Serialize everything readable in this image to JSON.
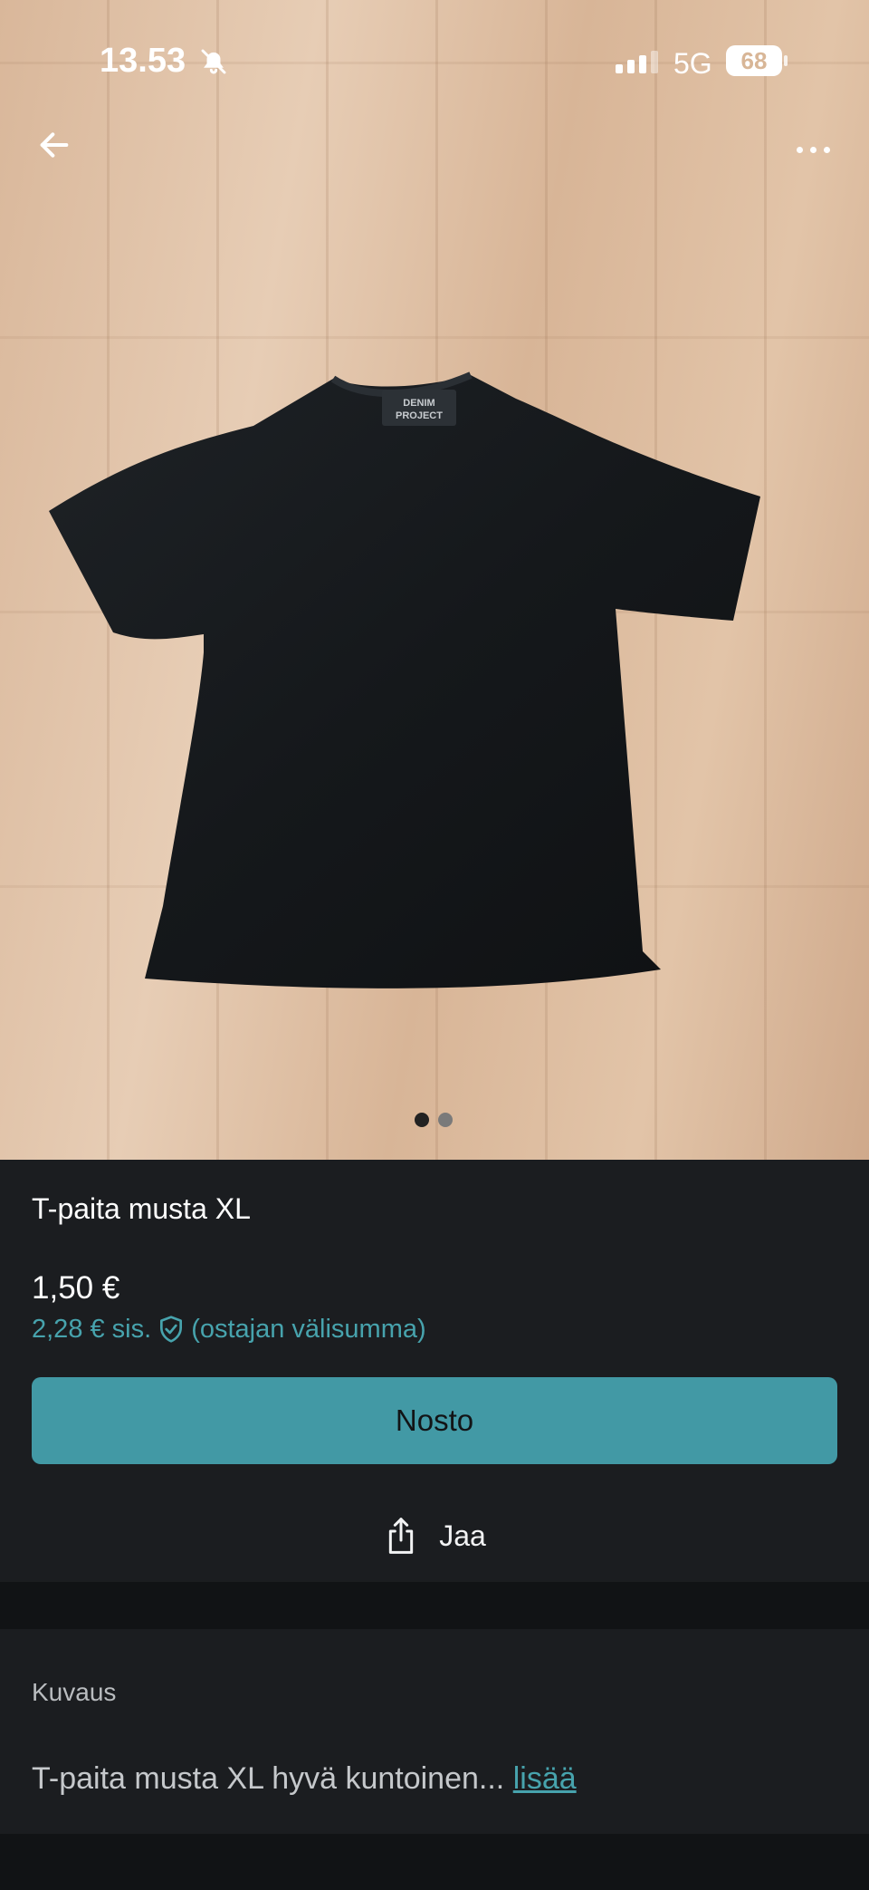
{
  "status_bar": {
    "time": "13.53",
    "network": "5G",
    "battery": "68"
  },
  "icons": {
    "back": "arrow-left-icon",
    "more": "more-horizontal-icon",
    "bell_off": "bell-off-icon",
    "shield": "shield-check-icon",
    "share": "share-icon"
  },
  "gallery": {
    "current_page": 1,
    "page_count": 2
  },
  "listing": {
    "title": "T-paita musta XL",
    "price": "1,50 €",
    "price_incl": "2,28 € sis.",
    "price_incl_note": "(ostajan välisumma)",
    "buy_label": "Nosto",
    "share_label": "Jaa"
  },
  "description": {
    "label": "Kuvaus",
    "text": "T-paita musta XL hyvä kuntoinen...",
    "more_label": "lisää"
  },
  "colors": {
    "accent": "#4299a5",
    "link": "#47a3ad",
    "panel": "#1b1d20",
    "background": "#121416"
  }
}
